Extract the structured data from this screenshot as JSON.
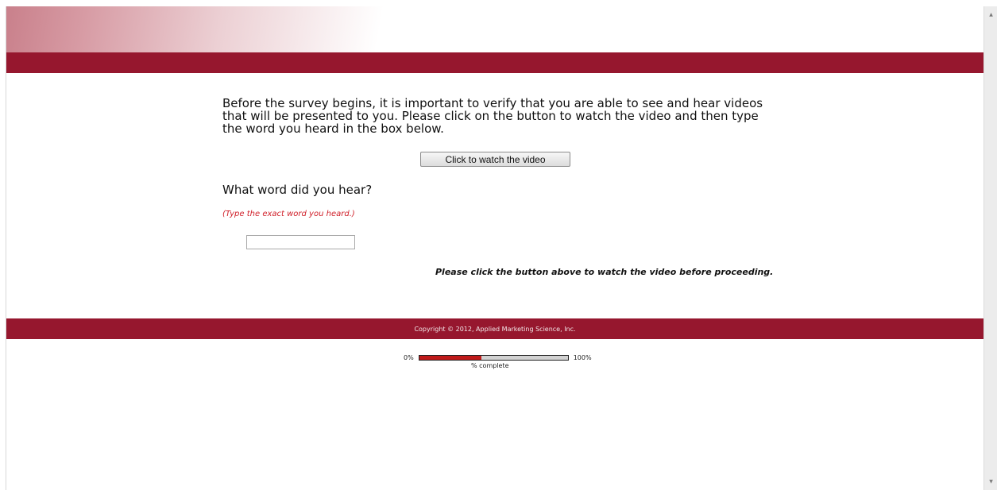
{
  "intro_text": "Before the survey begins, it is important to verify that you are able to see and hear videos that will be presented to you. Please click on the button to watch the video and then type the word you heard in the box below.",
  "watch_button_label": "Click to watch the video",
  "question": {
    "label": "What word did you hear?",
    "hint": "(Type the exact word you heard.)",
    "answer_value": ""
  },
  "notice": "Please click the button above to watch the video before proceeding.",
  "footer_text": "Copyright © 2012, Applied Marketing Science, Inc.",
  "progress": {
    "min_label": "0%",
    "max_label": "100%",
    "caption": "% complete",
    "fraction": 0.42
  },
  "colors": {
    "brand": "#96172e",
    "progress_fill": "#c01a1a",
    "hint": "#d0202a"
  },
  "scrollbar": {
    "up_icon": "arrow-up-icon",
    "down_icon": "arrow-down-icon"
  }
}
